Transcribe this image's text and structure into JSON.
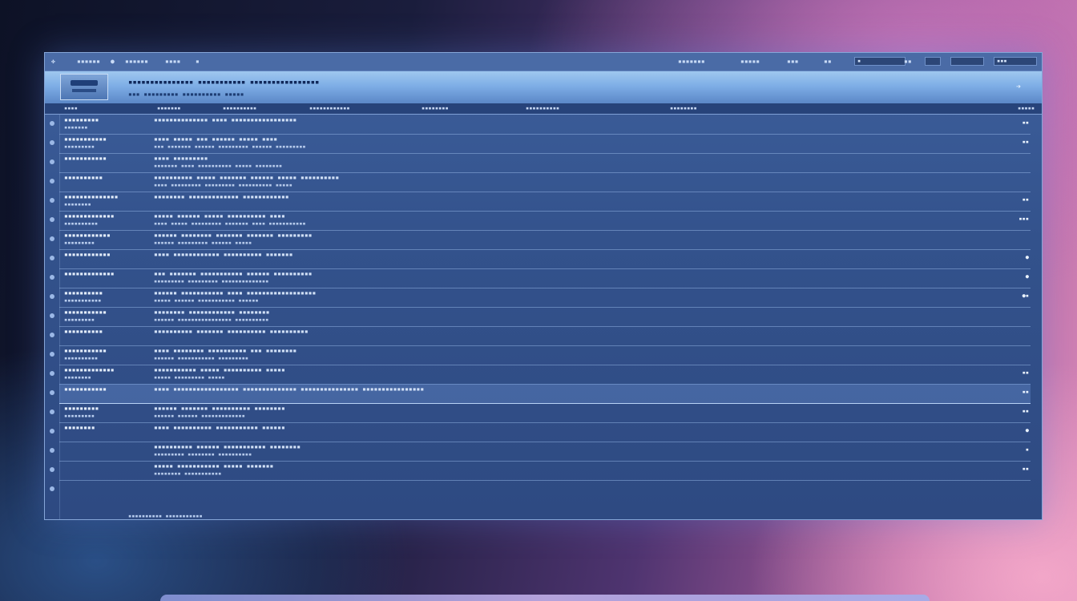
{
  "toolbar": {
    "items": [
      "✤",
      "▪▪▪▪▪▪",
      "●",
      "▪▪▪▪▪▪",
      "▪▪▪▪",
      "▪"
    ],
    "right_items": [
      "▪▪▪▪▪▪▪",
      "▪▪▪▪▪",
      "▪▪▪",
      "▪▪",
      "▪▪"
    ],
    "boxes": [
      "▪",
      "",
      "",
      "▪▪▪"
    ]
  },
  "banner": {
    "title": "▪▪▪▪▪▪▪▪▪▪▪▪▪▪▪ ▪▪▪▪▪▪▪▪▪▪▪ ▪▪▪▪▪▪▪▪▪▪▪▪▪▪▪▪",
    "subtitle": "▪▪▪ ▪▪▪▪▪▪▪▪▪ ▪▪▪▪▪▪▪▪▪▪ ▪▪▪▪▪"
  },
  "columns": [
    "▪▪▪▪",
    "▪▪▪▪▪▪▪",
    "▪▪▪▪▪▪▪▪▪▪",
    "▪▪▪▪▪▪▪▪▪▪▪▪",
    "▪▪▪▪▪▪▪▪",
    "▪▪▪▪▪▪▪▪▪▪",
    "▪▪▪▪▪▪▪▪",
    "▪▪▪▪▪"
  ],
  "rows": [
    {
      "label": "▪▪▪▪▪▪▪▪▪",
      "label2": "▪▪▪▪▪▪▪",
      "text": "▪▪▪▪▪▪▪▪▪▪▪▪▪▪ ▪▪▪▪ ▪▪▪▪▪▪▪▪▪▪▪▪▪▪▪▪▪",
      "text2": "",
      "status": "▪▪"
    },
    {
      "label": "▪▪▪▪▪▪▪▪▪▪▪",
      "label2": "▪▪▪▪▪▪▪▪▪",
      "text": "▪▪▪▪ ▪▪▪▪▪ ▪▪▪ ▪▪▪▪▪▪ ▪▪▪▪▪ ▪▪▪▪",
      "text2": "▪▪▪ ▪▪▪▪▪▪▪ ▪▪▪▪▪▪ ▪▪▪▪▪▪▪▪▪ ▪▪▪▪▪▪ ▪▪▪▪▪▪▪▪▪",
      "status": "▪▪"
    },
    {
      "label": "▪▪▪▪▪▪▪▪▪▪▪",
      "label2": "",
      "text": "▪▪▪▪ ▪▪▪▪▪▪▪▪▪",
      "text2": "▪▪▪▪▪▪▪ ▪▪▪▪ ▪▪▪▪▪▪▪▪▪▪ ▪▪▪▪▪ ▪▪▪▪▪▪▪▪",
      "status": ""
    },
    {
      "label": "▪▪▪▪▪▪▪▪▪▪",
      "label2": "",
      "text": "▪▪▪▪▪▪▪▪▪▪ ▪▪▪▪▪ ▪▪▪▪▪▪▪ ▪▪▪▪▪▪ ▪▪▪▪▪ ▪▪▪▪▪▪▪▪▪▪",
      "text2": "▪▪▪▪ ▪▪▪▪▪▪▪▪▪ ▪▪▪▪▪▪▪▪▪ ▪▪▪▪▪▪▪▪▪▪ ▪▪▪▪▪",
      "status": ""
    },
    {
      "label": "▪▪▪▪▪▪▪▪▪▪▪▪▪▪",
      "label2": "▪▪▪▪▪▪▪▪",
      "text": "▪▪▪▪▪▪▪▪ ▪▪▪▪▪▪▪▪▪▪▪▪▪ ▪▪▪▪▪▪▪▪▪▪▪▪",
      "text2": "",
      "status": "▪▪"
    },
    {
      "label": "▪▪▪▪▪▪▪▪▪▪▪▪▪",
      "label2": "▪▪▪▪▪▪▪▪▪▪",
      "text": "▪▪▪▪▪ ▪▪▪▪▪▪ ▪▪▪▪▪ ▪▪▪▪▪▪▪▪▪▪ ▪▪▪▪",
      "text2": "▪▪▪▪ ▪▪▪▪▪ ▪▪▪▪▪▪▪▪▪ ▪▪▪▪▪▪▪ ▪▪▪▪ ▪▪▪▪▪▪▪▪▪▪▪",
      "status": "▪▪▪"
    },
    {
      "label": "▪▪▪▪▪▪▪▪▪▪▪▪",
      "label2": "▪▪▪▪▪▪▪▪▪",
      "text": "▪▪▪▪▪▪ ▪▪▪▪▪▪▪▪ ▪▪▪▪▪▪▪ ▪▪▪▪▪▪▪ ▪▪▪▪▪▪▪▪▪",
      "text2": "▪▪▪▪▪▪ ▪▪▪▪▪▪▪▪▪ ▪▪▪▪▪▪ ▪▪▪▪▪",
      "status": ""
    },
    {
      "label": "▪▪▪▪▪▪▪▪▪▪▪▪",
      "label2": "",
      "text": "▪▪▪▪ ▪▪▪▪▪▪▪▪▪▪▪▪ ▪▪▪▪▪▪▪▪▪▪ ▪▪▪▪▪▪▪",
      "text2": "",
      "status": "●"
    },
    {
      "label": "▪▪▪▪▪▪▪▪▪▪▪▪▪",
      "label2": "",
      "text": "▪▪▪ ▪▪▪▪▪▪▪ ▪▪▪▪▪▪▪▪▪▪▪ ▪▪▪▪▪▪ ▪▪▪▪▪▪▪▪▪▪",
      "text2": "▪▪▪▪▪▪▪▪▪ ▪▪▪▪▪▪▪▪▪ ▪▪▪▪▪▪▪▪▪▪▪▪▪▪",
      "status": "●"
    },
    {
      "label": "▪▪▪▪▪▪▪▪▪▪",
      "label2": "▪▪▪▪▪▪▪▪▪▪▪",
      "text": "▪▪▪▪▪▪ ▪▪▪▪▪▪▪▪▪▪▪ ▪▪▪▪ ▪▪▪▪▪▪▪▪▪▪▪▪▪▪▪▪▪▪",
      "text2": "▪▪▪▪▪ ▪▪▪▪▪▪ ▪▪▪▪▪▪▪▪▪▪▪ ▪▪▪▪▪▪",
      "status": "●▪"
    },
    {
      "label": "▪▪▪▪▪▪▪▪▪▪▪",
      "label2": "▪▪▪▪▪▪▪▪▪",
      "text": "▪▪▪▪▪▪▪▪ ▪▪▪▪▪▪▪▪▪▪▪▪ ▪▪▪▪▪▪▪▪",
      "text2": "▪▪▪▪▪▪ ▪▪▪▪▪▪▪▪▪▪▪▪▪▪▪▪ ▪▪▪▪▪▪▪▪▪▪",
      "status": ""
    },
    {
      "label": "▪▪▪▪▪▪▪▪▪▪",
      "label2": "",
      "text": "▪▪▪▪▪▪▪▪▪▪ ▪▪▪▪▪▪▪ ▪▪▪▪▪▪▪▪▪▪ ▪▪▪▪▪▪▪▪▪▪",
      "text2": "",
      "status": ""
    },
    {
      "label": "▪▪▪▪▪▪▪▪▪▪▪",
      "label2": "▪▪▪▪▪▪▪▪▪▪",
      "text": "▪▪▪▪ ▪▪▪▪▪▪▪▪ ▪▪▪▪▪▪▪▪▪▪ ▪▪▪ ▪▪▪▪▪▪▪▪",
      "text2": "▪▪▪▪▪▪ ▪▪▪▪▪▪▪▪▪▪▪ ▪▪▪▪▪▪▪▪▪",
      "status": ""
    },
    {
      "label": "▪▪▪▪▪▪▪▪▪▪▪▪▪",
      "label2": "▪▪▪▪▪▪▪▪",
      "text": "▪▪▪▪▪▪▪▪▪▪▪ ▪▪▪▪▪ ▪▪▪▪▪▪▪▪▪▪ ▪▪▪▪▪",
      "text2": "▪▪▪▪▪ ▪▪▪▪▪▪▪▪▪ ▪▪▪▪▪",
      "status": "▪▪"
    },
    {
      "label": "▪▪▪▪▪▪▪▪▪▪▪",
      "label2": "",
      "text": "▪▪▪▪ ▪▪▪▪▪▪▪▪▪▪▪▪▪▪▪▪▪ ▪▪▪▪▪▪▪▪▪▪▪▪▪▪ ▪▪▪▪▪▪▪▪▪▪▪▪▪▪▪ ▪▪▪▪▪▪▪▪▪▪▪▪▪▪▪▪",
      "text2": "",
      "status": "▪▪"
    },
    {
      "label": "▪▪▪▪▪▪▪▪▪",
      "label2": "▪▪▪▪▪▪▪▪▪",
      "text": "▪▪▪▪▪▪ ▪▪▪▪▪▪▪ ▪▪▪▪▪▪▪▪▪▪ ▪▪▪▪▪▪▪▪",
      "text2": "▪▪▪▪▪▪ ▪▪▪▪▪▪ ▪▪▪▪▪▪▪▪▪▪▪▪▪",
      "status": "▪▪"
    },
    {
      "label": "▪▪▪▪▪▪▪▪",
      "label2": "",
      "text": "▪▪▪▪ ▪▪▪▪▪▪▪▪▪▪ ▪▪▪▪▪▪▪▪▪▪▪ ▪▪▪▪▪▪",
      "text2": "",
      "status": "●"
    },
    {
      "label": "",
      "label2": "",
      "text": "▪▪▪▪▪▪▪▪▪▪ ▪▪▪▪▪▪ ▪▪▪▪▪▪▪▪▪▪▪ ▪▪▪▪▪▪▪▪",
      "text2": "▪▪▪▪▪▪▪▪▪ ▪▪▪▪▪▪▪▪ ▪▪▪▪▪▪▪▪▪▪",
      "status": "▪"
    },
    {
      "label": "",
      "label2": "",
      "text": "▪▪▪▪▪ ▪▪▪▪▪▪▪▪▪▪▪ ▪▪▪▪▪ ▪▪▪▪▪▪▪",
      "text2": "▪▪▪▪▪▪▪▪ ▪▪▪▪▪▪▪▪▪▪▪",
      "status": "▪▪"
    }
  ],
  "footer": {
    "text": "▪▪▪▪▪▪▪▪▪▪ ▪▪▪▪▪▪▪▪▪▪▪"
  }
}
